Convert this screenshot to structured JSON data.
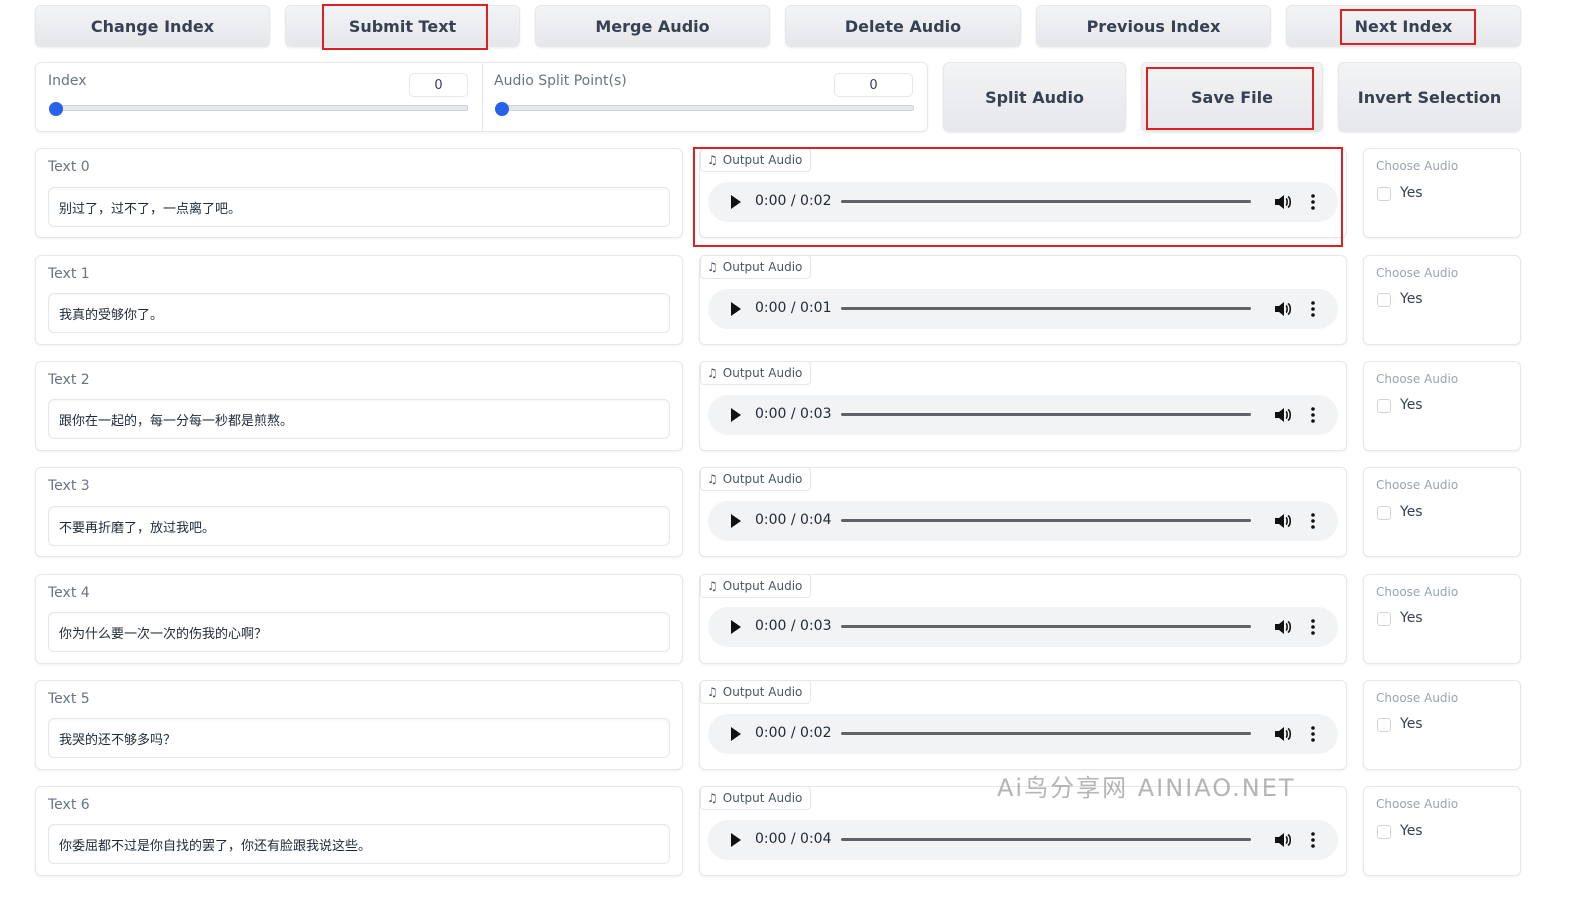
{
  "toolbar": {
    "change_index": "Change Index",
    "submit_text": "Submit Text",
    "merge_audio": "Merge Audio",
    "delete_audio": "Delete Audio",
    "previous_index": "Previous Index",
    "next_index": "Next Index"
  },
  "controls": {
    "index_label": "Index",
    "index_value": "0",
    "split_label": "Audio Split Point(s)",
    "split_value": "0",
    "split_audio": "Split Audio",
    "save_file": "Save File",
    "invert_selection": "Invert Selection"
  },
  "audio_label": "Output Audio",
  "choose_label": "Choose Audio",
  "yes_label": "Yes",
  "rows": [
    {
      "label": "Text 0",
      "text": "别过了，过不了，一点离了吧。",
      "time": "0:00 / 0:02"
    },
    {
      "label": "Text 1",
      "text": "我真的受够你了。",
      "time": "0:00 / 0:01"
    },
    {
      "label": "Text 2",
      "text": "跟你在一起的，每一分每一秒都是煎熬。",
      "time": "0:00 / 0:03"
    },
    {
      "label": "Text 3",
      "text": "不要再折磨了，放过我吧。",
      "time": "0:00 / 0:04"
    },
    {
      "label": "Text 4",
      "text": "你为什么要一次一次的伤我的心啊？",
      "time": "0:00 / 0:03"
    },
    {
      "label": "Text 5",
      "text": "我哭的还不够多吗？",
      "time": "0:00 / 0:02"
    },
    {
      "label": "Text 6",
      "text": "你委屈都不过是你自找的罢了，你还有脸跟我说这些。",
      "time": "0:00 / 0:04"
    }
  ],
  "watermark": "Ai鸟分享网  AINIAO.NET",
  "colors": {
    "highlight": "#e02020",
    "slider": "#2563eb"
  }
}
